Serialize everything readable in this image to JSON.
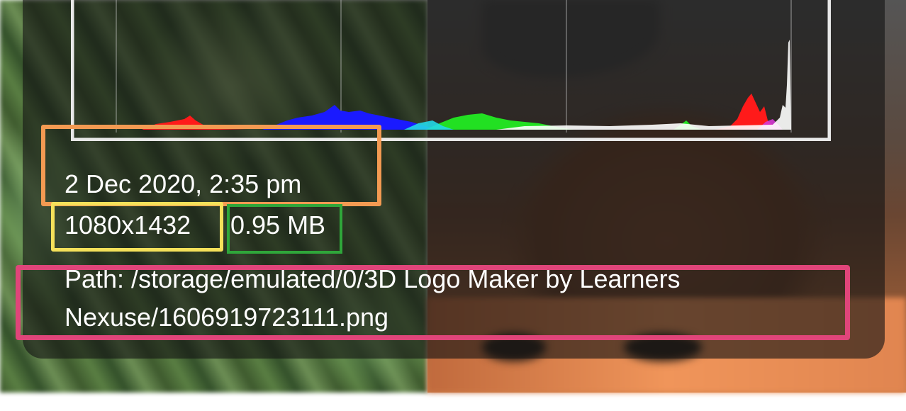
{
  "file_details": {
    "date_time": "2 Dec 2020, 2:35 pm",
    "resolution": "1080x1432",
    "file_size": "0.95 MB",
    "path_line1": "Path:  /storage/emulated/0/3D Logo Maker by Learners",
    "path_line2": "Nexuse/1606919723111.png"
  },
  "histogram": {
    "channels": [
      "red",
      "green",
      "blue",
      "luminance"
    ],
    "colors": {
      "red": "#ff1a1a",
      "green": "#22e022",
      "blue": "#1a1aff",
      "luminance": "#ffffff",
      "frame": "#e8e8e8"
    }
  },
  "highlights": {
    "date_box_color": "#f39a52",
    "resolution_box_color": "#f5e15a",
    "size_box_color": "#2fa63a",
    "path_box_color": "#e0457a"
  }
}
